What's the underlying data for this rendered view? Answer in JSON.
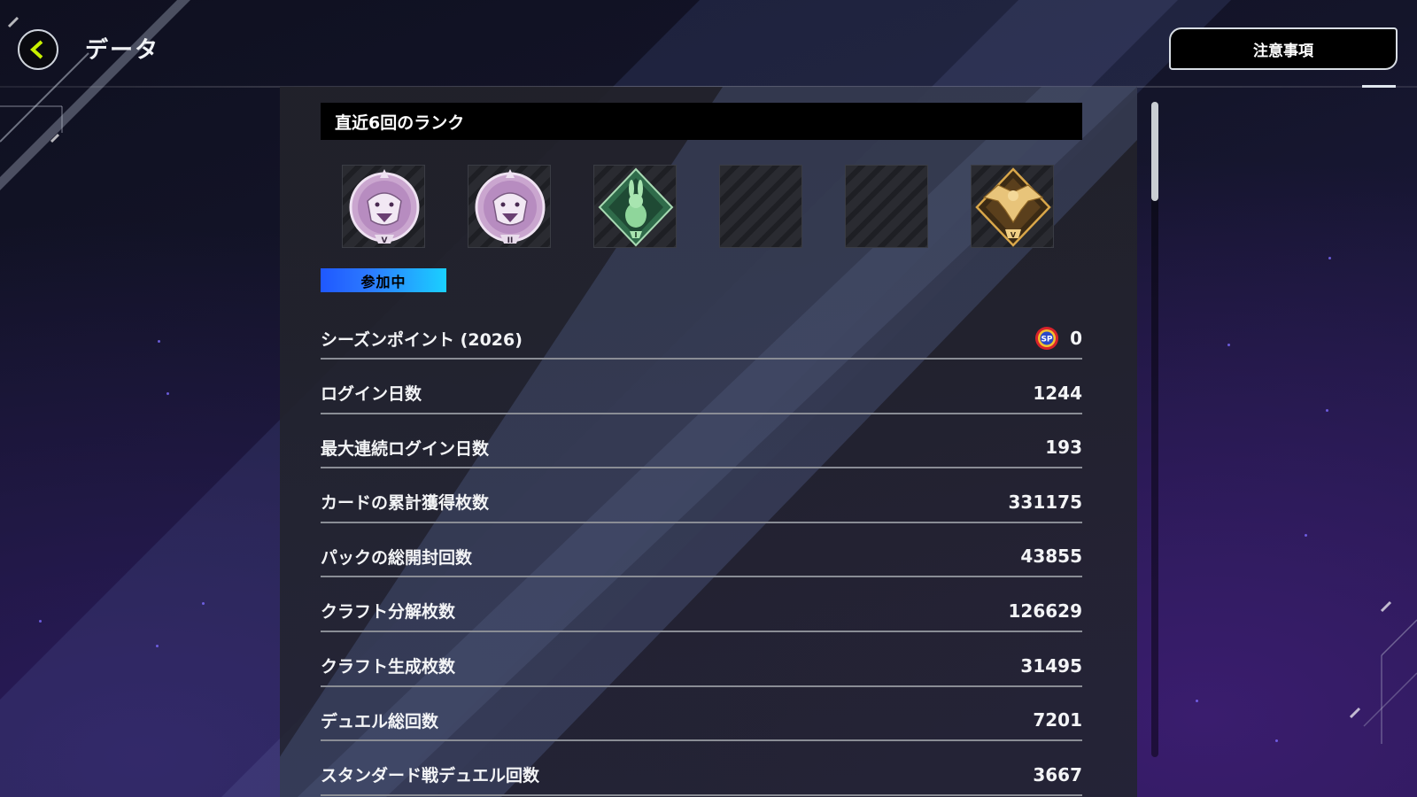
{
  "header": {
    "title": "データ",
    "notice_label": "注意事項"
  },
  "rank_section": {
    "title": "直近6回のランク",
    "ranks": [
      {
        "tier": "platinum",
        "icon": "tiger-icon",
        "numeral": "V"
      },
      {
        "tier": "platinum",
        "icon": "tiger-icon",
        "numeral": "II"
      },
      {
        "tier": "rookie",
        "icon": "rabbit-icon",
        "numeral": "I"
      },
      {
        "tier": "empty",
        "icon": "empty-slot",
        "numeral": ""
      },
      {
        "tier": "empty",
        "icon": "empty-slot",
        "numeral": ""
      },
      {
        "tier": "gold",
        "icon": "eagle-icon",
        "numeral": "V"
      }
    ],
    "status_badge": "参加中"
  },
  "stats": [
    {
      "label": "シーズンポイント (2026)",
      "value": "0",
      "icon": "sp-icon"
    },
    {
      "label": "ログイン日数",
      "value": "1244"
    },
    {
      "label": "最大連続ログイン日数",
      "value": "193"
    },
    {
      "label": "カードの累計獲得枚数",
      "value": "331175"
    },
    {
      "label": "パックの総開封回数",
      "value": "43855"
    },
    {
      "label": "クラフト分解枚数",
      "value": "126629"
    },
    {
      "label": "クラフト生成枚数",
      "value": "31495"
    },
    {
      "label": "デュエル総回数",
      "value": "7201"
    },
    {
      "label": "スタンダード戦デュエル回数",
      "value": "3667"
    }
  ],
  "colors": {
    "accent_back": "#c8f000",
    "badge_start": "#1f58ff",
    "badge_end": "#1ad0ff"
  }
}
